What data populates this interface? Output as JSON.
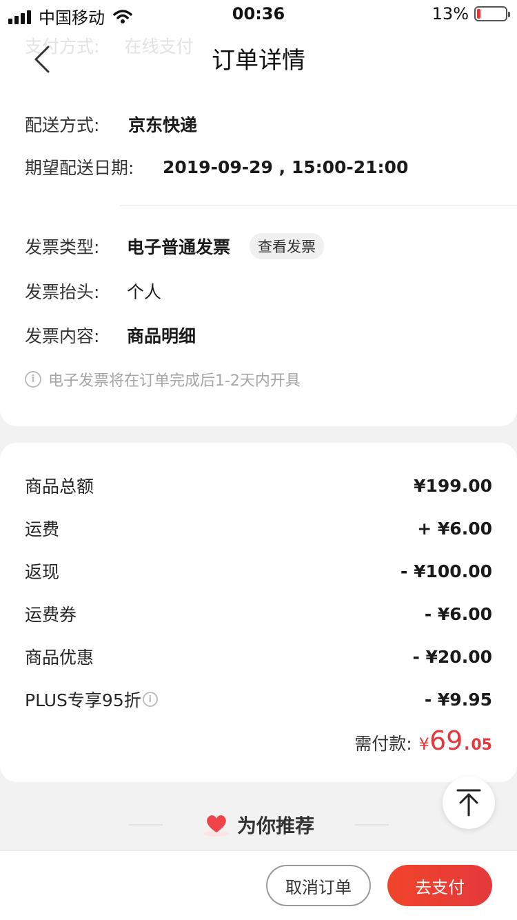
{
  "status_bar": {
    "carrier": "中国移动",
    "time": "00:36",
    "battery": "13%",
    "battery_level": 0.13
  },
  "nav": {
    "title": "订单详情",
    "ghost_label": "支付方式:",
    "ghost_value": "在线支付"
  },
  "delivery": {
    "method_label": "配送方式:",
    "method_value": "京东快递",
    "date_label": "期望配送日期:",
    "date_value": "2019-09-29 , 15:00-21:00"
  },
  "invoice": {
    "type_label": "发票类型:",
    "type_value": "电子普通发票",
    "view_button": "查看发票",
    "title_label": "发票抬头:",
    "title_value": "个人",
    "content_label": "发票内容:",
    "content_value": "商品明细",
    "note": "电子发票将在订单完成后1-2天内开具"
  },
  "price": {
    "rows": [
      {
        "label": "商品总额",
        "amount": "¥199.00"
      },
      {
        "label": "运费",
        "amount": "+ ¥6.00"
      },
      {
        "label": "返现",
        "amount": "- ¥100.00"
      },
      {
        "label": "运费券",
        "amount": "- ¥6.00"
      },
      {
        "label": "商品优惠",
        "amount": "- ¥20.00"
      },
      {
        "label": "PLUS专享95折",
        "amount": "- ¥9.95"
      }
    ],
    "total_label": "需付款:",
    "total_currency": "¥",
    "total_int": "69.",
    "total_dec": "05"
  },
  "recommend": {
    "title": "为你推荐"
  },
  "actions": {
    "cancel": "取消订单",
    "pay": "去支付"
  },
  "colors": {
    "accent": "#e4393c"
  }
}
